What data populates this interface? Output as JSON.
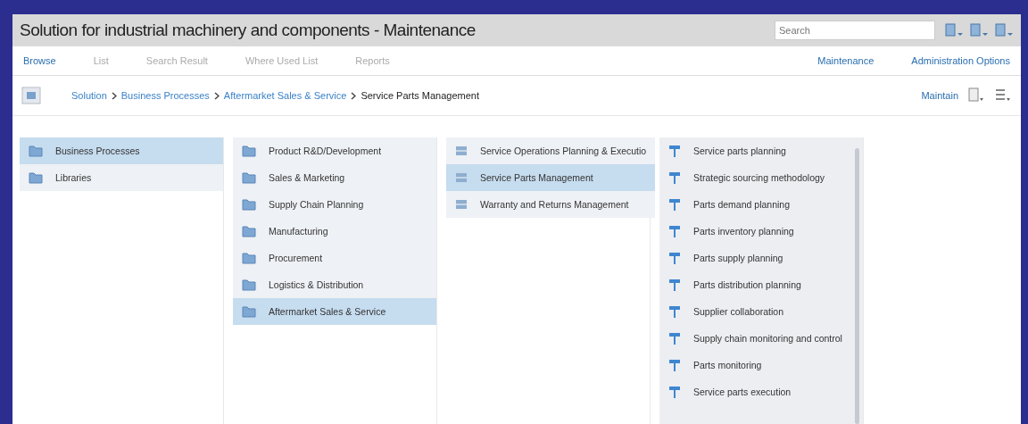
{
  "window": {
    "title": "Solution for industrial machinery and components - Maintenance"
  },
  "search": {
    "placeholder": "Search"
  },
  "nav_tabs": [
    {
      "label": "Browse",
      "selected": true
    },
    {
      "label": "List",
      "selected": false
    },
    {
      "label": "Search Result",
      "selected": false
    },
    {
      "label": "Where Used List",
      "selected": false
    },
    {
      "label": "Reports",
      "selected": false
    }
  ],
  "nav_links": [
    "Maintenance",
    "Administration Options"
  ],
  "breadcrumb": [
    "Solution",
    "Business Processes",
    "Aftermarket Sales & Service",
    "Service Parts Management"
  ],
  "actions_link": "Maintain",
  "columns": [
    {
      "items": [
        {
          "label": "Business Processes",
          "kind": "folder",
          "selected": true
        },
        {
          "label": "Libraries",
          "kind": "folder",
          "selected": false
        }
      ]
    },
    {
      "items": [
        {
          "label": "Product R&D/Development",
          "kind": "folder",
          "selected": false
        },
        {
          "label": "Sales & Marketing",
          "kind": "folder",
          "selected": false
        },
        {
          "label": "Supply Chain Planning",
          "kind": "folder",
          "selected": false
        },
        {
          "label": "Manufacturing",
          "kind": "folder",
          "selected": false
        },
        {
          "label": "Procurement",
          "kind": "folder",
          "selected": false
        },
        {
          "label": "Logistics & Distribution",
          "kind": "folder",
          "selected": false
        },
        {
          "label": "Aftermarket Sales & Service",
          "kind": "folder",
          "selected": true
        }
      ]
    },
    {
      "items": [
        {
          "label": "Service Operations Planning & Executio",
          "kind": "scenario",
          "selected": false
        },
        {
          "label": "Service Parts Management",
          "kind": "scenario",
          "selected": true
        },
        {
          "label": "Warranty and Returns Management",
          "kind": "scenario",
          "selected": false
        }
      ]
    },
    {
      "items": [
        {
          "label": "Service parts planning",
          "kind": "process",
          "selected": false
        },
        {
          "label": "Strategic sourcing methodology",
          "kind": "process",
          "selected": false
        },
        {
          "label": "Parts demand planning",
          "kind": "process",
          "selected": false
        },
        {
          "label": "Parts inventory planning",
          "kind": "process",
          "selected": false
        },
        {
          "label": "Parts supply planning",
          "kind": "process",
          "selected": false
        },
        {
          "label": "Parts distribution planning",
          "kind": "process",
          "selected": false
        },
        {
          "label": "Supplier collaboration",
          "kind": "process",
          "selected": false
        },
        {
          "label": "Supply chain monitoring and control",
          "kind": "process",
          "selected": false
        },
        {
          "label": "Parts monitoring",
          "kind": "process",
          "selected": false
        },
        {
          "label": "Service parts execution",
          "kind": "process",
          "selected": false
        }
      ]
    }
  ]
}
